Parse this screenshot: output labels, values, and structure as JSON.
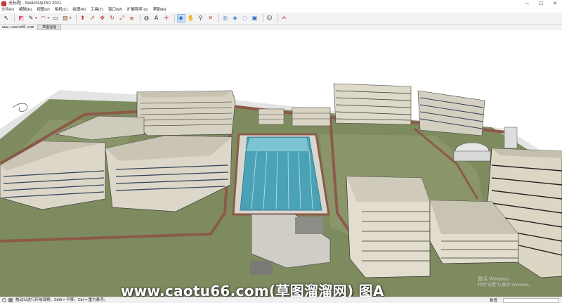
{
  "window": {
    "title": "无标题 - SketchUp Pro 2021",
    "minimize": "—",
    "maximize": "☐",
    "close": "✕"
  },
  "menu": [
    "文件(F)",
    "编辑(E)",
    "视图(V)",
    "相机(C)",
    "绘图(R)",
    "工具(T)",
    "窗口(W)",
    "扩展程序 (x)",
    "帮助(H)"
  ],
  "toolbar": {
    "icons": [
      {
        "name": "select-icon",
        "glyph": "↖",
        "color": "#222222",
        "selected": false
      },
      {
        "name": "eraser-icon",
        "glyph": "◩",
        "color": "#d9568a",
        "selected": false
      },
      {
        "name": "pencil-icon",
        "glyph": "✎",
        "color": "#333333",
        "selected": false
      },
      {
        "name": "arc-icon",
        "glyph": "◠",
        "color": "#c0392b",
        "selected": false
      },
      {
        "name": "rectangle-icon",
        "glyph": "▭",
        "color": "#444444",
        "selected": false
      },
      {
        "name": "paint-bucket-icon",
        "glyph": "▨",
        "color": "#8b5a2b",
        "selected": false
      },
      {
        "name": "push-pull-icon",
        "glyph": "⬆",
        "color": "#c0392b",
        "selected": false
      },
      {
        "name": "follow-me-icon",
        "glyph": "➚",
        "color": "#c0392b",
        "selected": false
      },
      {
        "name": "move-icon",
        "glyph": "✥",
        "color": "#c0392b",
        "selected": false
      },
      {
        "name": "rotate-icon",
        "glyph": "↻",
        "color": "#c0392b",
        "selected": false
      },
      {
        "name": "scale-icon",
        "glyph": "⤢",
        "color": "#c0392b",
        "selected": false
      },
      {
        "name": "offset-icon",
        "glyph": "⧈",
        "color": "#c0392b",
        "selected": false
      },
      {
        "name": "tape-measure-icon",
        "glyph": "◍",
        "color": "#333333",
        "selected": false
      },
      {
        "name": "text-icon",
        "glyph": "A",
        "color": "#333333",
        "selected": false
      },
      {
        "name": "axes-icon",
        "glyph": "✛",
        "color": "#c0392b",
        "selected": false
      },
      {
        "name": "orbit-icon",
        "glyph": "◉",
        "color": "#2a6fc9",
        "selected": true
      },
      {
        "name": "pan-icon",
        "glyph": "✋",
        "color": "#8b5a2b",
        "selected": false
      },
      {
        "name": "zoom-icon",
        "glyph": "⚲",
        "color": "#333333",
        "selected": false
      },
      {
        "name": "zoom-extents-icon",
        "glyph": "✕",
        "color": "#c0392b",
        "selected": false
      },
      {
        "name": "warehouse-icon",
        "glyph": "◎",
        "color": "#2a6fc9",
        "selected": false
      },
      {
        "name": "extension-warehouse-icon",
        "glyph": "◈",
        "color": "#2a6fc9",
        "selected": false
      },
      {
        "name": "share-model-icon",
        "glyph": "◌",
        "color": "#2a6fc9",
        "selected": false
      },
      {
        "name": "layout-icon",
        "glyph": "▣",
        "color": "#2a6fc9",
        "selected": false
      },
      {
        "name": "account-icon",
        "glyph": "☺",
        "color": "#444444",
        "selected": false
      },
      {
        "name": "edit-note-icon",
        "glyph": "✍",
        "color": "#c0392b",
        "selected": false
      }
    ]
  },
  "tabs": {
    "watermark": "www.caotu66.com",
    "scene": "草图溜溜"
  },
  "overlay": {
    "site_watermark": "www.caotu66.com(草图溜溜网) 图A",
    "activate_line1": "激活 Windows",
    "activate_line2": "转到\"设置\"以激活 Windows。"
  },
  "status": {
    "hint": "拖动以进行环绕观察。Shift = 平移。Ctrl = 重力悬浮。",
    "measure_label": "数值",
    "measure_value": ""
  },
  "colors": {
    "ground": "#dfe1e2",
    "lawn": "#7d8a5e",
    "road": "#8b5a4a",
    "water": "#4aa3b8",
    "roof": "#c9c5b6"
  }
}
